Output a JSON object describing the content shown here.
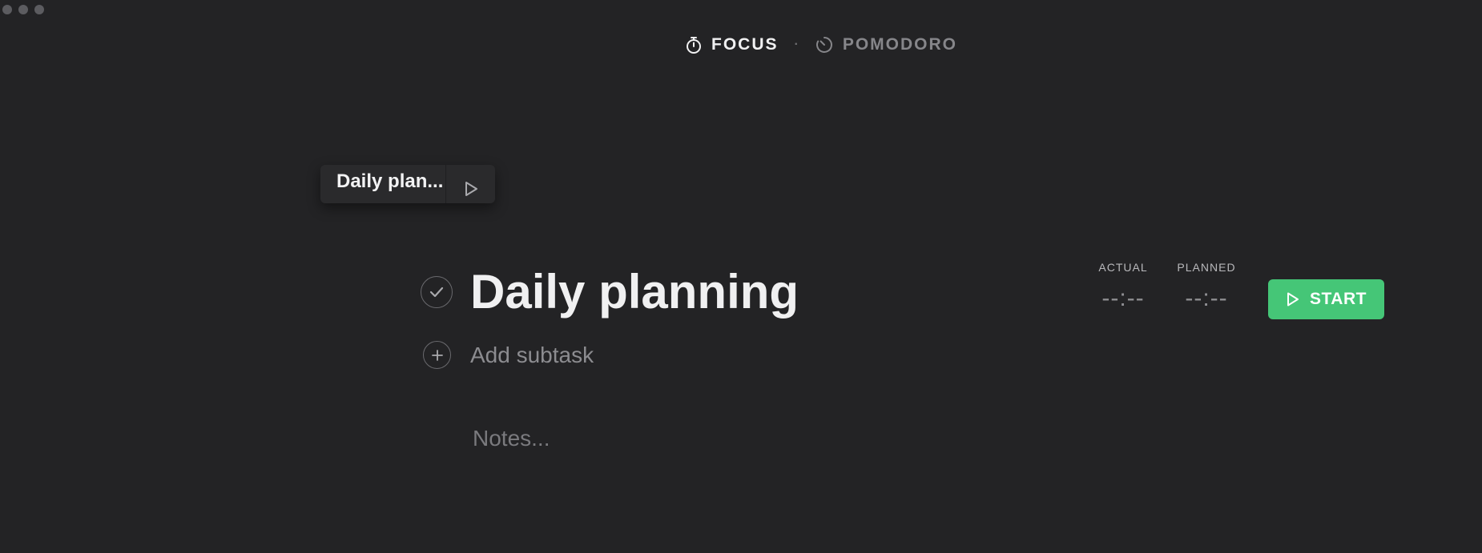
{
  "window": {
    "controls": [
      "close",
      "minimize",
      "zoom"
    ]
  },
  "modes": {
    "focus": {
      "label": "FOCUS",
      "icon": "stopwatch-icon"
    },
    "separator": "·",
    "pomodoro": {
      "label": "POMODORO",
      "icon": "pomodoro-timer-icon"
    }
  },
  "mini_timer": {
    "title": "Daily plan...",
    "icon": "play-icon"
  },
  "task": {
    "title": "Daily planning",
    "complete_icon": "checkmark-icon",
    "add_subtask_placeholder": "Add subtask",
    "add_icon": "plus-icon",
    "notes_placeholder": "Notes..."
  },
  "timers": {
    "actual": {
      "label": "ACTUAL",
      "value": "--:--"
    },
    "planned": {
      "label": "PLANNED",
      "value": "--:--"
    }
  },
  "start_button": {
    "label": "START",
    "icon": "play-icon"
  },
  "colors": {
    "background": "#232325",
    "accent_green": "#45c677",
    "text_primary": "#f0f0f1",
    "text_muted": "#8c8c90"
  }
}
